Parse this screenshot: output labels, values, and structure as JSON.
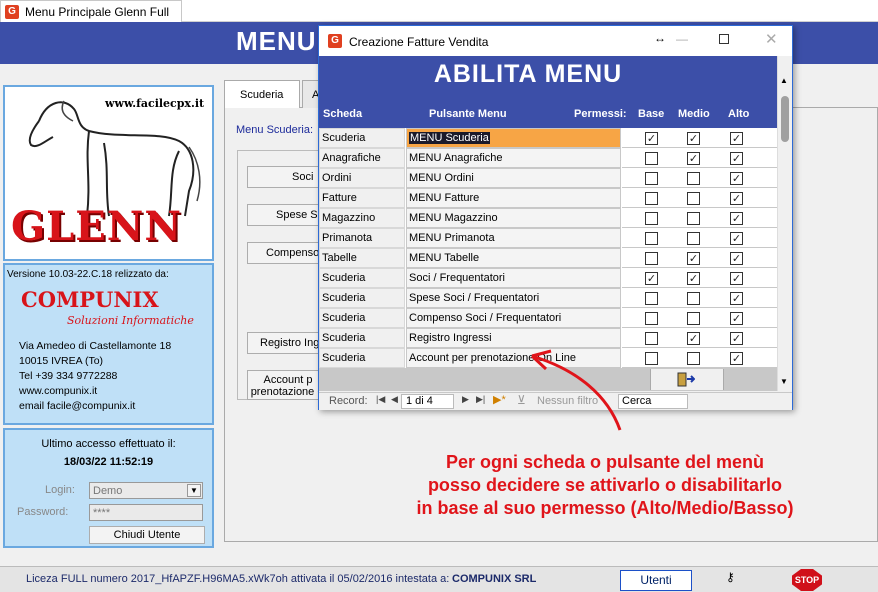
{
  "main_window": {
    "tab_title": "Menu Principale Glenn Full",
    "header_title": "MENU",
    "back_tabs": [
      "Scuderia",
      "A"
    ],
    "menu_label": "Menu Scuderia:",
    "back_buttons": [
      "Soci",
      "Spese Sc",
      "Compenso",
      "Registro Ing",
      "Account p\nprenotazione C"
    ]
  },
  "left_panel": {
    "logo": {
      "url": "www.facilecpx.it",
      "brand": "GLENN"
    },
    "version_text": "Versione  10.03-22.C.18  relizzato da:",
    "company": "COMPUNIX",
    "company_sub": "Soluzioni Informatiche",
    "address_lines": [
      "Via Amedeo di Castellamonte 18",
      "10015  IVREA   (To)",
      "Tel +39 334 9772288",
      "www.compunix.it",
      "email facile@compunix.it"
    ],
    "last_access_label": "Ultimo accesso effettuato il:",
    "last_access_value": "18/03/22 11:52:19",
    "login_label": "Login:",
    "login_value": "Demo",
    "password_label": "Password:",
    "password_value": "****",
    "logout_button": "Chiudi Utente"
  },
  "status_bar": {
    "license_text": "Liceza FULL numero 2017_HfAPZF.H96MA5.xWk7oh attivata il 05/02/2016 intestata a:",
    "license_owner": "COMPUNIX SRL",
    "users_button": "Utenti",
    "stop_label": "STOP"
  },
  "dialog": {
    "title": "Creazione Fatture Vendita",
    "header": "ABILITA MENU",
    "columns": {
      "scheda": "Scheda",
      "pulsante": "Pulsante Menu",
      "permessi": "Permessi:",
      "base": "Base",
      "medio": "Medio",
      "alto": "Alto"
    },
    "rows": [
      {
        "scheda": "Scuderia",
        "pulsante": "MENU Scuderia",
        "base": true,
        "medio": true,
        "alto": true,
        "selected": true
      },
      {
        "scheda": "Anagrafiche",
        "pulsante": "MENU Anagrafiche",
        "base": false,
        "medio": true,
        "alto": true
      },
      {
        "scheda": "Ordini",
        "pulsante": "MENU Ordini",
        "base": false,
        "medio": false,
        "alto": true
      },
      {
        "scheda": "Fatture",
        "pulsante": "MENU Fatture",
        "base": false,
        "medio": false,
        "alto": true
      },
      {
        "scheda": "Magazzino",
        "pulsante": "MENU Magazzino",
        "base": false,
        "medio": false,
        "alto": true
      },
      {
        "scheda": "Primanota",
        "pulsante": "MENU Primanota",
        "base": false,
        "medio": false,
        "alto": true
      },
      {
        "scheda": "Tabelle",
        "pulsante": "MENU Tabelle",
        "base": false,
        "medio": true,
        "alto": true
      },
      {
        "scheda": "Scuderia",
        "pulsante": "Soci / Frequentatori",
        "base": true,
        "medio": true,
        "alto": true
      },
      {
        "scheda": "Scuderia",
        "pulsante": "Spese Soci / Frequentatori",
        "base": false,
        "medio": false,
        "alto": true
      },
      {
        "scheda": "Scuderia",
        "pulsante": "Compenso Soci / Frequentatori",
        "base": false,
        "medio": false,
        "alto": true
      },
      {
        "scheda": "Scuderia",
        "pulsante": "Registro Ingressi",
        "base": false,
        "medio": true,
        "alto": true
      },
      {
        "scheda": "Scuderia",
        "pulsante": "Account per prenotazione On Line",
        "base": false,
        "medio": false,
        "alto": true
      }
    ],
    "nav": {
      "record_label": "Record:",
      "position": "1 di 4",
      "no_filter": "Nessun filtro",
      "search": "Cerca"
    }
  },
  "annotation": {
    "lines": [
      "Per ogni scheda o pulsante del menù",
      "posso decidere se attivarlo o disabilitarlo",
      "in base al suo permesso (Alto/Medio/Basso)"
    ],
    "color": "#e0141a"
  }
}
